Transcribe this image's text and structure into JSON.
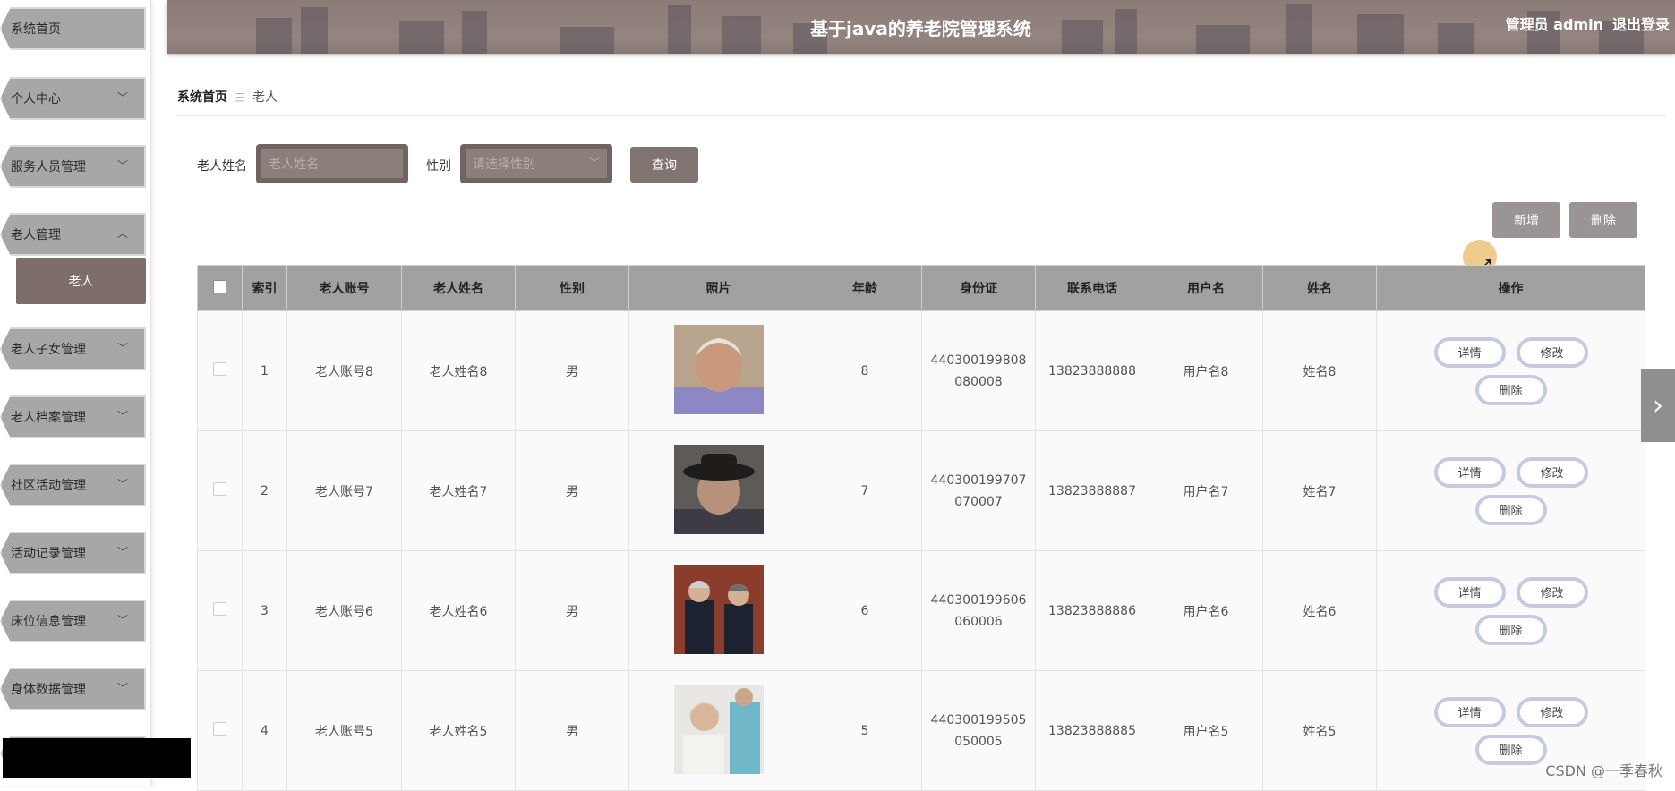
{
  "app": {
    "title": "基于java的养老院管理系统",
    "user_role": "管理员 admin",
    "logout": "退出登录"
  },
  "sidebar": {
    "items": [
      {
        "label": "系统首页",
        "expandable": false
      },
      {
        "label": "个人中心",
        "expandable": true
      },
      {
        "label": "服务人员管理",
        "expandable": true
      },
      {
        "label": "老人管理",
        "expandable": true,
        "expanded": true
      },
      {
        "label": "老人子女管理",
        "expandable": true
      },
      {
        "label": "老人档案管理",
        "expandable": true
      },
      {
        "label": "社区活动管理",
        "expandable": true
      },
      {
        "label": "活动记录管理",
        "expandable": true
      },
      {
        "label": "床位信息管理",
        "expandable": true
      },
      {
        "label": "身体数据管理",
        "expandable": true
      }
    ],
    "active_sub": "老人"
  },
  "breadcrumb": {
    "home": "系统首页",
    "separator": "三",
    "current": "老人"
  },
  "search": {
    "name_label": "老人姓名",
    "name_placeholder": "老人姓名",
    "gender_label": "性别",
    "gender_placeholder": "请选择性别",
    "query_button": "查询"
  },
  "actions": {
    "add": "新增",
    "delete": "删除"
  },
  "table": {
    "columns": [
      "",
      "索引",
      "老人账号",
      "老人姓名",
      "性别",
      "照片",
      "年龄",
      "身份证",
      "联系电话",
      "用户名",
      "姓名",
      "操作"
    ],
    "rows": [
      {
        "index": "1",
        "account": "老人账号8",
        "name": "老人姓名8",
        "gender": "男",
        "age": "8",
        "id_line1": "440300199808",
        "id_line2": "080008",
        "phone": "13823888888",
        "username": "用户名8",
        "realname": "姓名8"
      },
      {
        "index": "2",
        "account": "老人账号7",
        "name": "老人姓名7",
        "gender": "男",
        "age": "7",
        "id_line1": "440300199707",
        "id_line2": "070007",
        "phone": "13823888887",
        "username": "用户名7",
        "realname": "姓名7"
      },
      {
        "index": "3",
        "account": "老人账号6",
        "name": "老人姓名6",
        "gender": "男",
        "age": "6",
        "id_line1": "440300199606",
        "id_line2": "060006",
        "phone": "13823888886",
        "username": "用户名6",
        "realname": "姓名6"
      },
      {
        "index": "4",
        "account": "老人账号5",
        "name": "老人姓名5",
        "gender": "男",
        "age": "5",
        "id_line1": "440300199505",
        "id_line2": "050005",
        "phone": "13823888885",
        "username": "用户名5",
        "realname": "姓名5"
      }
    ],
    "row_actions": {
      "detail": "详情",
      "edit": "修改",
      "delete": "删除"
    }
  },
  "watermark": "CSDN @一季春秋",
  "colors": {
    "header": "#8c7c77",
    "sidebar_item": "#a7a7a7",
    "active_sub": "#7d6e69",
    "table_header": "#a3a19f",
    "action_border": "#c7c9e0"
  }
}
